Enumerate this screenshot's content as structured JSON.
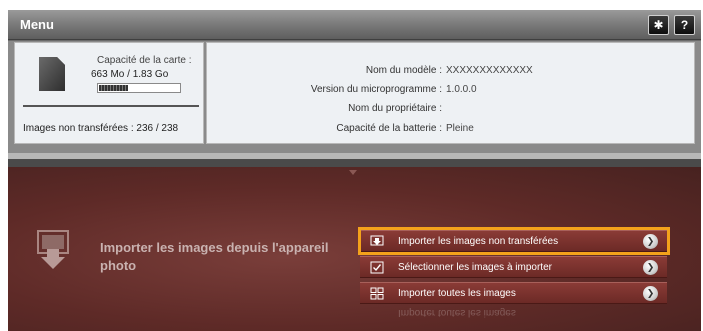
{
  "window": {
    "title": "Menu",
    "settings_icon": "gear-icon",
    "help_label": "?"
  },
  "card": {
    "icon": "memory-card-icon",
    "capacity_label": "Capacité de la carte :",
    "capacity_value": "663 Mo /  1.83 Go",
    "usage_fraction": 0.36,
    "untransferred": "Images non transférées : 236 / 238"
  },
  "device_info": {
    "rows": [
      {
        "label": "Nom du modèle :",
        "value": "XXXXXXXXXXXXX"
      },
      {
        "label": "Version du microprogramme :",
        "value": "1.0.0.0"
      },
      {
        "label": "Nom du propriétaire :",
        "value": ""
      },
      {
        "label": "Capacité de la batterie :",
        "value": "Pleine"
      }
    ]
  },
  "import": {
    "icon": "import-photo-icon",
    "title": "Importer les images depuis l'appareil photo",
    "buttons": [
      {
        "label": "Importer les images non transférées",
        "icon": "import-icon",
        "highlighted": true
      },
      {
        "label": "Sélectionner les images à importer",
        "icon": "checkbox-icon",
        "highlighted": false
      },
      {
        "label": "Importer toutes les images",
        "icon": "grid-icon",
        "highlighted": false
      }
    ],
    "highlight_color": "#f4a21b"
  }
}
